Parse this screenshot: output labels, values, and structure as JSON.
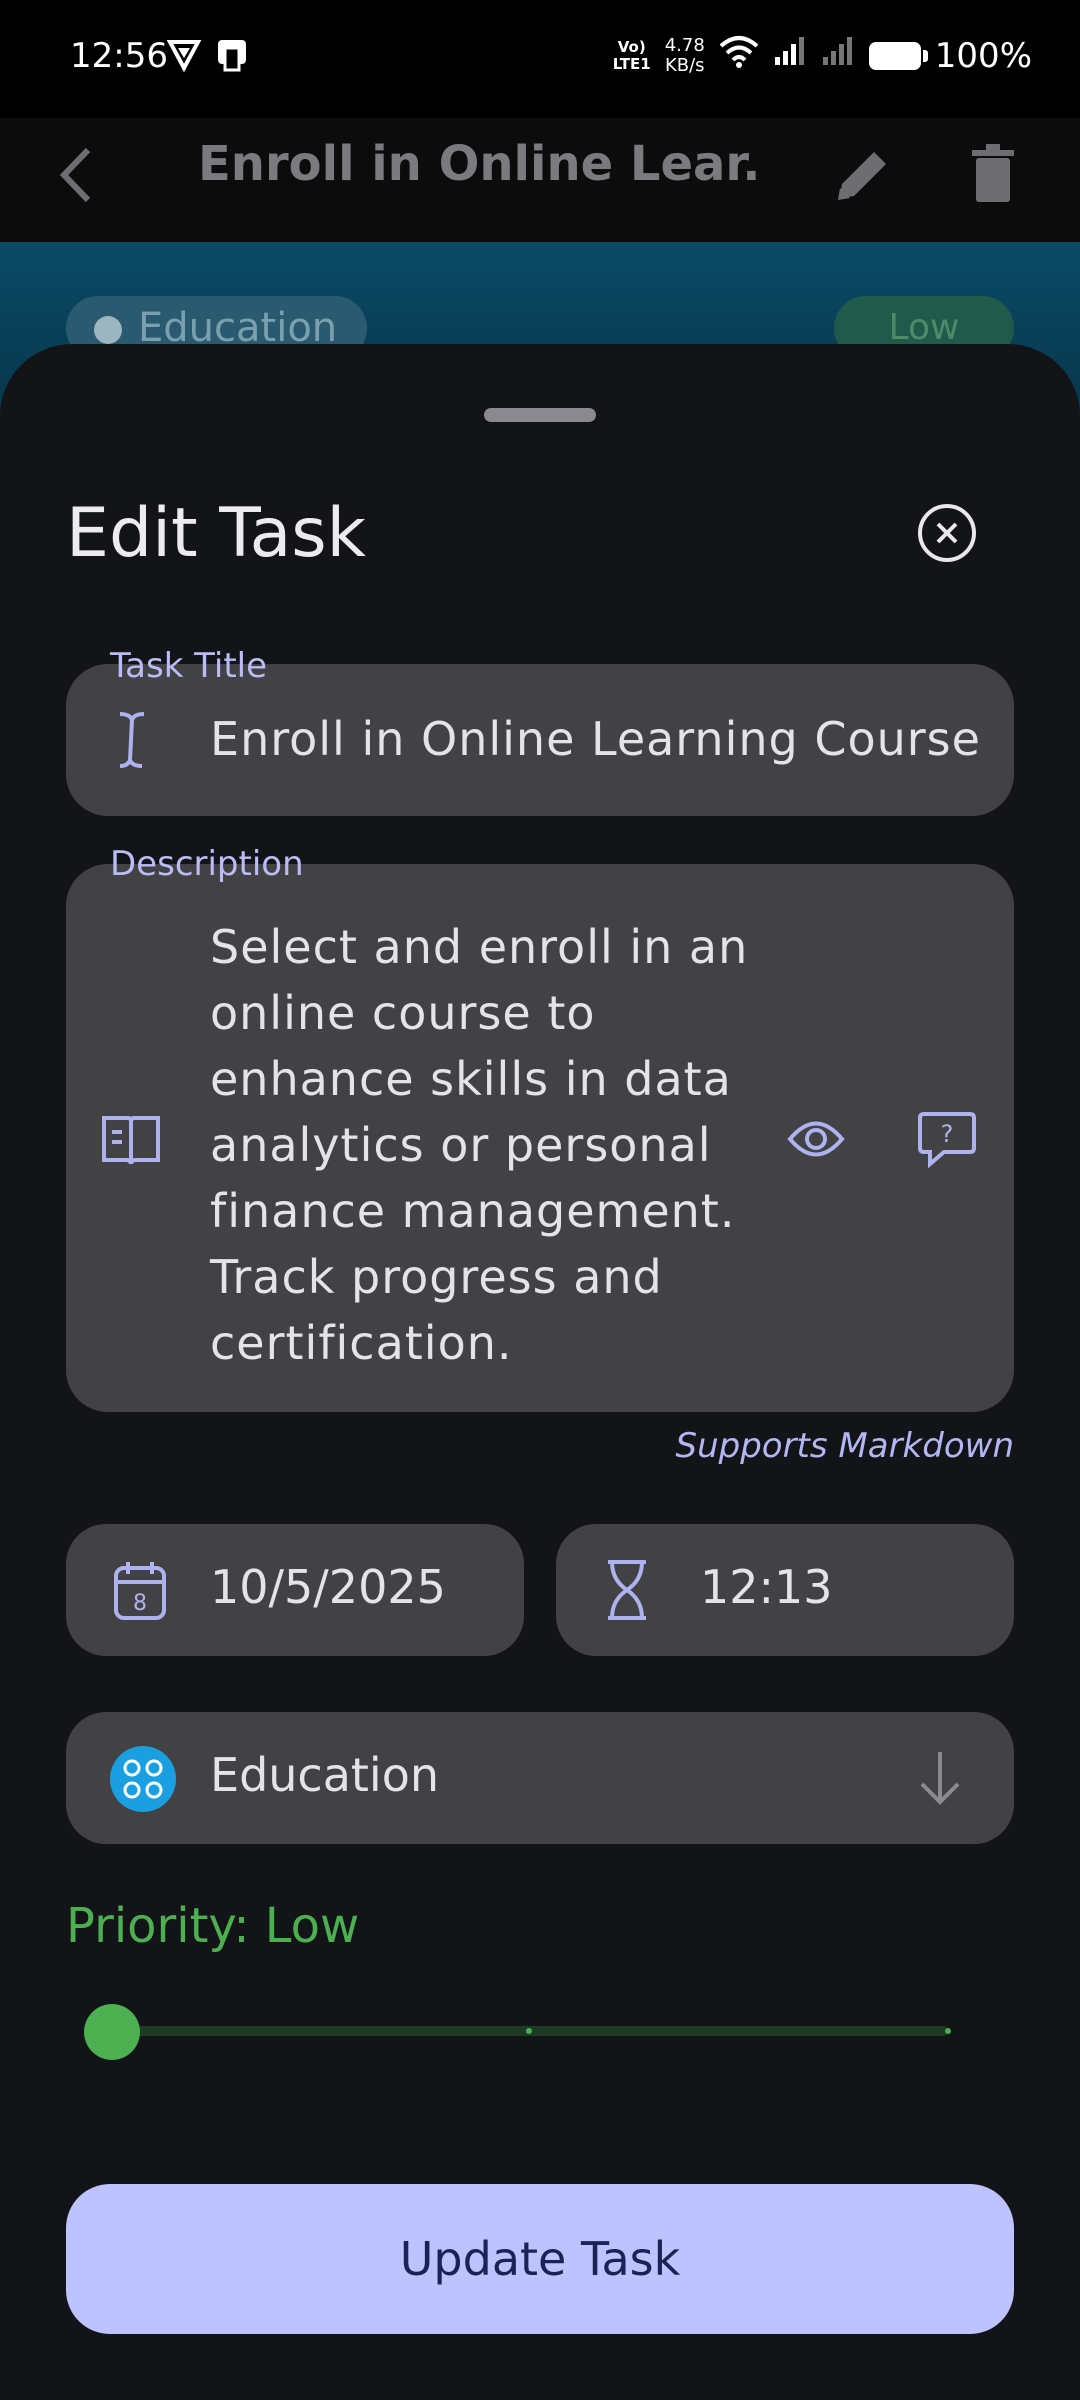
{
  "status_bar": {
    "time": "12:56",
    "net_speed_value": "4.78",
    "net_speed_unit": "KB/s",
    "volte_top": "Vo)",
    "volte_bottom": "LTE1",
    "battery": "100%"
  },
  "app_bar": {
    "title": "Enroll in Online Lear...",
    "icons": [
      "back-arrow-icon",
      "pencil-icon",
      "trash-icon"
    ]
  },
  "hero": {
    "category_chip": "Education",
    "priority_chip": "Low"
  },
  "sheet": {
    "title": "Edit Task",
    "task_title_label": "Task Title",
    "task_title_value": "Enroll in Online Learning Course",
    "description_label": "Description",
    "description_value": "Select and enroll in an online course to enhance skills in data analytics or personal finance management. Track progress and certification.",
    "markdown_note": "Supports Markdown",
    "date_value": "10/5/2025",
    "date_icon_day": "8",
    "time_value": "12:13",
    "category_value": "Education",
    "priority_label": "Priority: Low",
    "priority_level": 0,
    "priority_levels": 3,
    "update_button": "Update Task"
  },
  "colors": {
    "accent": "#bcc3ff",
    "label": "#b9bcf5",
    "priority": "#4caf50",
    "category": "#1aa0e0",
    "field_bg": "#424244",
    "sheet_bg": "#131418"
  }
}
